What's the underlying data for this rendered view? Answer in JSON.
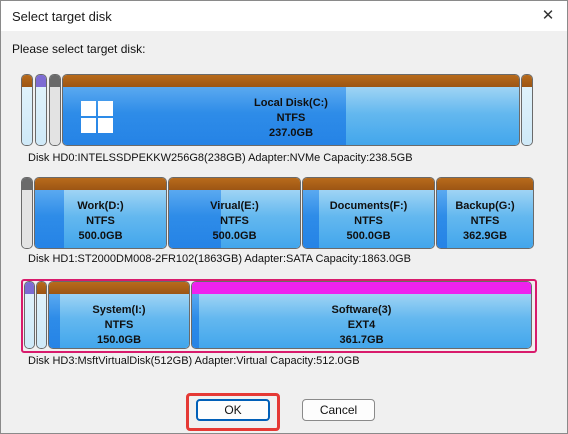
{
  "window": {
    "title": "Select target disk",
    "close_glyph": "✕"
  },
  "prompt": "Please select target disk:",
  "disks": [
    {
      "info": "Disk HD0:INTELSSDPEKKW256G8(238GB)  Adapter:NVMe  Capacity:238.5GB",
      "partitions": [
        {
          "name": "Local Disk(C:)",
          "fs": "NTFS",
          "size": "237.0GB"
        }
      ]
    },
    {
      "info": "Disk HD1:ST2000DM008-2FR102(1863GB)  Adapter:SATA  Capacity:1863.0GB",
      "partitions": [
        {
          "name": "Work(D:)",
          "fs": "NTFS",
          "size": "500.0GB"
        },
        {
          "name": "Virual(E:)",
          "fs": "NTFS",
          "size": "500.0GB"
        },
        {
          "name": "Documents(F:)",
          "fs": "NTFS",
          "size": "500.0GB"
        },
        {
          "name": "Backup(G:)",
          "fs": "NTFS",
          "size": "362.9GB"
        }
      ]
    },
    {
      "info": "Disk HD3:MsftVirtualDisk(512GB)  Adapter:Virtual  Capacity:512.0GB",
      "partitions": [
        {
          "name": "System(I:)",
          "fs": "NTFS",
          "size": "150.0GB"
        },
        {
          "name": "Software(3)",
          "fs": "EXT4",
          "size": "361.7GB"
        }
      ]
    }
  ],
  "buttons": {
    "ok": "OK",
    "cancel": "Cancel"
  },
  "colors": {
    "selected_border": "#d81b6c",
    "highlight": "#e53935",
    "linux_cap": "#ee22ee",
    "windows_logo": "#ffffff"
  },
  "icons": {
    "close": "close-icon",
    "os": "windows-logo-icon"
  }
}
